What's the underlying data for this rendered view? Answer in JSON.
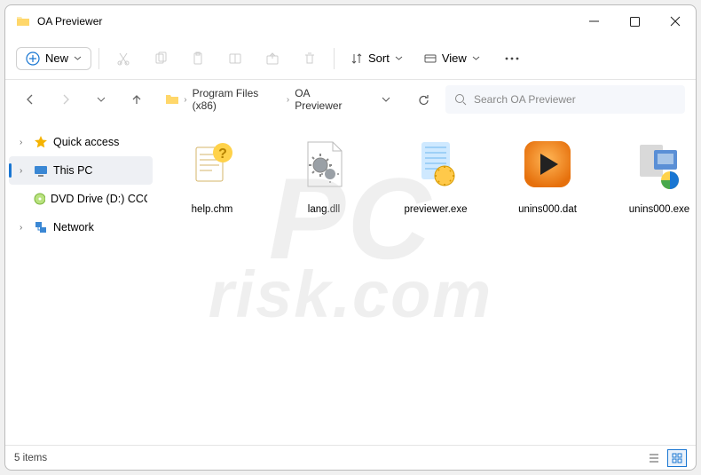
{
  "title": "OA Previewer",
  "toolbar": {
    "new": "New",
    "sort": "Sort",
    "view": "View"
  },
  "breadcrumb": {
    "seg1": "Program Files (x86)",
    "seg2": "OA Previewer"
  },
  "search": {
    "placeholder": "Search OA Previewer"
  },
  "sidebar": {
    "quick": "Quick access",
    "thispc": "This PC",
    "dvd": "DVD Drive (D:) CCCC",
    "network": "Network"
  },
  "files": [
    {
      "name": "help.chm"
    },
    {
      "name": "lang.dll"
    },
    {
      "name": "previewer.exe"
    },
    {
      "name": "unins000.dat"
    },
    {
      "name": "unins000.exe"
    }
  ],
  "status": {
    "count": "5 items"
  },
  "watermark": {
    "line1": "PC",
    "line2": "risk.com"
  }
}
